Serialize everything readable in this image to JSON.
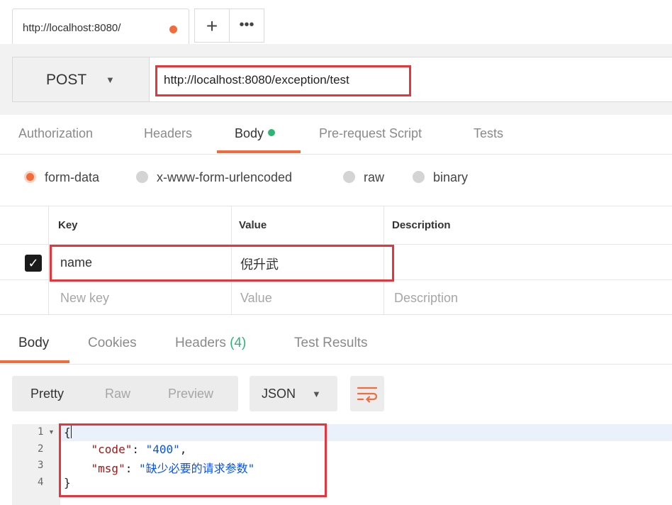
{
  "tab": {
    "title": "http://localhost:8080/",
    "plus": "+",
    "more": "•••"
  },
  "request": {
    "method": "POST",
    "url": "http://localhost:8080/exception/test"
  },
  "request_tabs": [
    {
      "label": "Authorization"
    },
    {
      "label": "Headers"
    },
    {
      "label": "Body"
    },
    {
      "label": "Pre-request Script"
    },
    {
      "label": "Tests"
    }
  ],
  "body_modes": [
    {
      "label": "form-data",
      "selected": true
    },
    {
      "label": "x-www-form-urlencoded",
      "selected": false
    },
    {
      "label": "raw",
      "selected": false
    },
    {
      "label": "binary",
      "selected": false
    }
  ],
  "params": {
    "headers": {
      "key": "Key",
      "value": "Value",
      "description": "Description"
    },
    "rows": [
      {
        "checked": true,
        "key": "name",
        "value": "倪升武",
        "description": ""
      }
    ],
    "placeholder": {
      "key": "New key",
      "value": "Value",
      "description": "Description"
    }
  },
  "response_tabs": {
    "body": "Body",
    "cookies": "Cookies",
    "headers": "Headers",
    "headers_count": "(4)",
    "test_results": "Test Results"
  },
  "view_modes": {
    "pretty": "Pretty",
    "raw": "Raw",
    "preview": "Preview"
  },
  "format": "JSON",
  "code": {
    "line_numbers": [
      "1",
      "2",
      "3",
      "4"
    ],
    "open": "{",
    "close": "}",
    "code_key": "\"code\"",
    "code_value": "\"400\"",
    "msg_key": "\"msg\"",
    "msg_value": "\"缺少必要的请求参数\""
  },
  "colors": {
    "accent": "#f26b3a",
    "highlight": "#e8353b",
    "success": "#2bb673"
  }
}
